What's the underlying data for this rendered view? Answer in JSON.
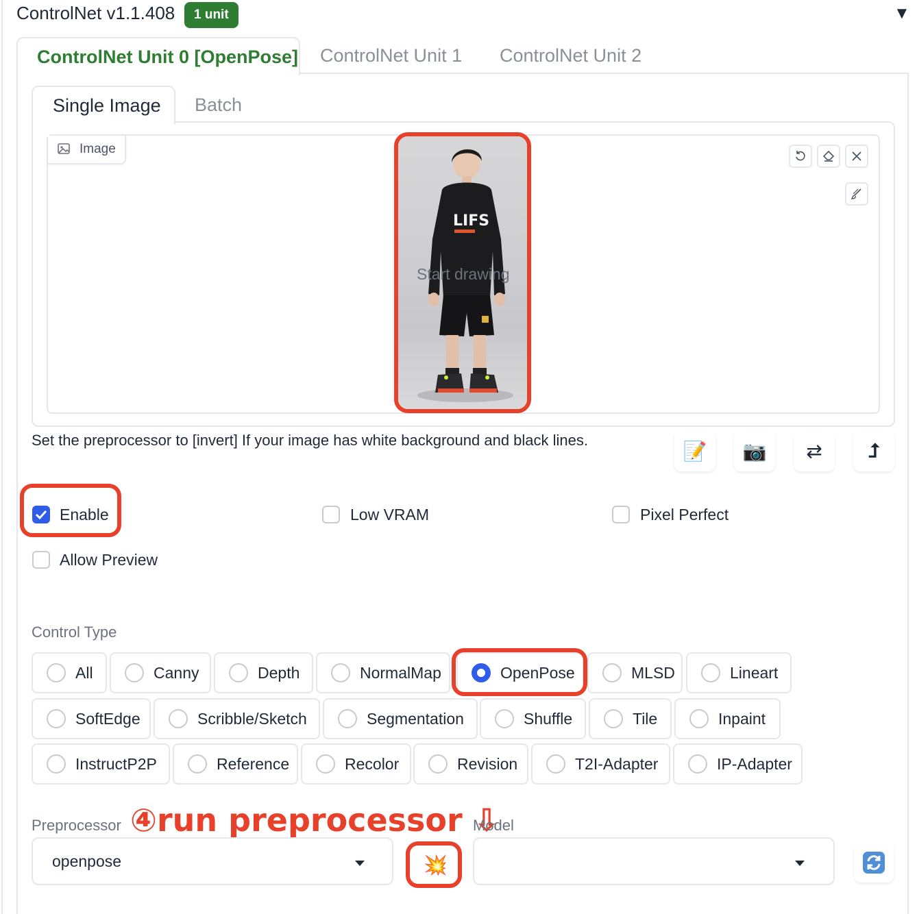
{
  "header": {
    "title": "ControlNet v1.1.408",
    "badge": "1 unit",
    "collapse_icon": "triangle-down-icon"
  },
  "unit_tabs": [
    {
      "label": "ControlNet Unit 0 [OpenPose]",
      "active": true
    },
    {
      "label": "ControlNet Unit 1",
      "active": false
    },
    {
      "label": "ControlNet Unit 2",
      "active": false
    }
  ],
  "image_tabs": [
    {
      "label": "Single Image",
      "active": true
    },
    {
      "label": "Batch",
      "active": false
    }
  ],
  "image_panel": {
    "label": "Image",
    "overlay_text": "Start drawing",
    "photo_shirt_text": "LIFS",
    "tools": [
      "undo-icon",
      "eraser-icon",
      "close-icon",
      "brush-icon"
    ]
  },
  "hint_text": "Set the preprocessor to [invert] If your image has white background and black lines.",
  "action_icons": [
    "memo-icon",
    "camera-icon",
    "swap-icon",
    "upload-arrow-icon"
  ],
  "action_glyphs": [
    "📝",
    "📷",
    "⇄",
    "⮥"
  ],
  "checkboxes": {
    "enable": {
      "label": "Enable",
      "checked": true
    },
    "low_vram": {
      "label": "Low VRAM",
      "checked": false
    },
    "pixel_perfect": {
      "label": "Pixel Perfect",
      "checked": false
    },
    "allow_preview": {
      "label": "Allow Preview",
      "checked": false
    }
  },
  "control_type": {
    "label": "Control Type",
    "selected": "OpenPose",
    "options": [
      "All",
      "Canny",
      "Depth",
      "NormalMap",
      "OpenPose",
      "MLSD",
      "Lineart",
      "SoftEdge",
      "Scribble/Sketch",
      "Segmentation",
      "Shuffle",
      "Tile",
      "Inpaint",
      "InstructP2P",
      "Reference",
      "Recolor",
      "Revision",
      "T2I-Adapter",
      "IP-Adapter"
    ]
  },
  "preprocessor": {
    "label": "Preprocessor",
    "value": "openpose"
  },
  "run_button": {
    "glyph": "💥",
    "icon": "explosion-icon"
  },
  "model": {
    "label": "Model",
    "value": ""
  },
  "refresh_icon": "refresh-icon",
  "annotation": "④run preprocessor ⇩",
  "colors": {
    "accent_green": "#2e7d32",
    "checked_blue": "#2f5ce9",
    "highlight_red": "#e8412b"
  }
}
